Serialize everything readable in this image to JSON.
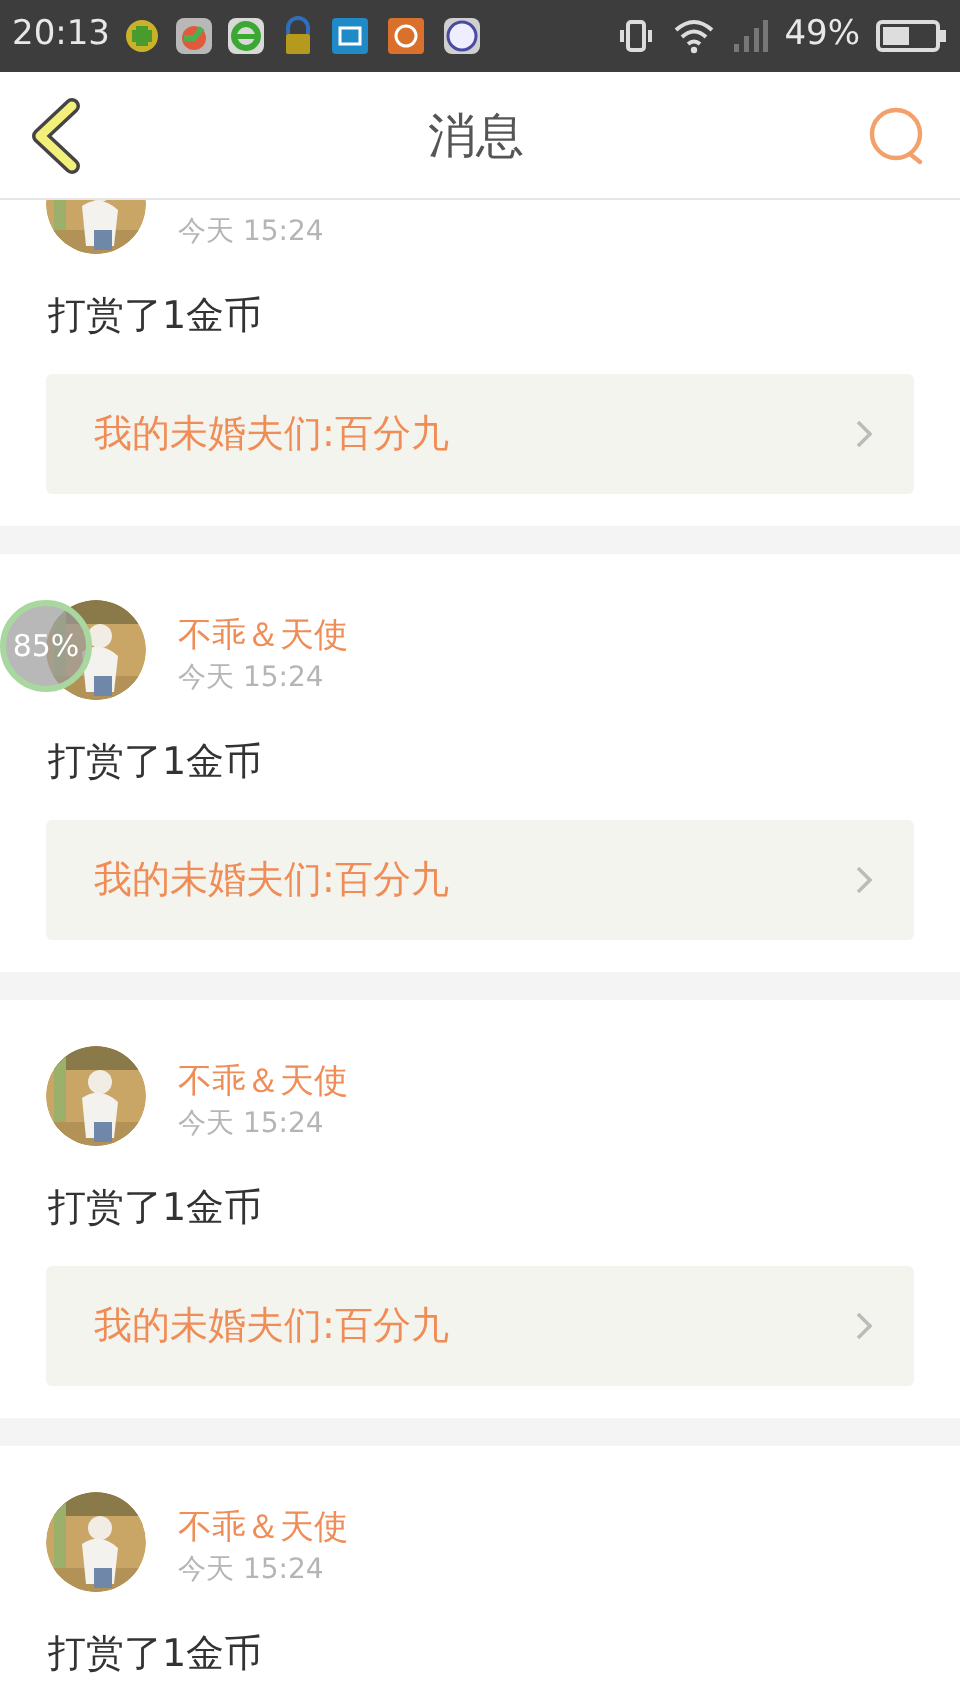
{
  "status_bar": {
    "time": "20:13",
    "battery_text": "49%"
  },
  "header": {
    "title": "消息"
  },
  "floating_badge": {
    "text": "85%"
  },
  "messages": [
    {
      "time": "今天 15:24",
      "text": "打赏了1金币",
      "quote": "我的未婚夫们:百分九"
    },
    {
      "name": "不乖＆天使",
      "time": "今天 15:24",
      "text": "打赏了1金币",
      "quote": "我的未婚夫们:百分九"
    },
    {
      "name": "不乖＆天使",
      "time": "今天 15:24",
      "text": "打赏了1金币",
      "quote": "我的未婚夫们:百分九"
    },
    {
      "name": "不乖＆天使",
      "time": "今天 15:24",
      "text": "打赏了1金币"
    }
  ]
}
